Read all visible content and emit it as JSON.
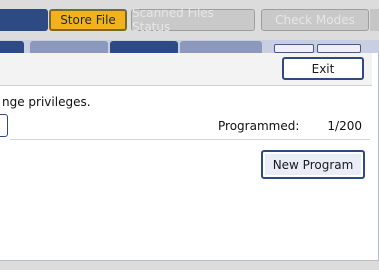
{
  "top_tabs": {
    "store_file": "Store File",
    "scanned_files_status": "Scanned Files Status",
    "check_modes": "Check Modes"
  },
  "header": {
    "exit_label": "Exit"
  },
  "main": {
    "message": "nge privileges.",
    "programmed_label": "Programmed:",
    "programmed_value": "1/200",
    "new_program_label": "New Program"
  },
  "colors": {
    "accent_dark_blue": "#2d4a83",
    "store_file_yellow": "#f2b21b",
    "disabled_gray": "#c9c9c9"
  }
}
